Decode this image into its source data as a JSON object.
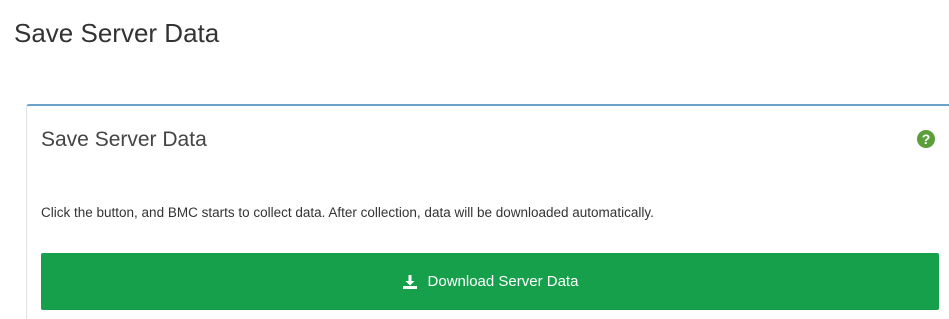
{
  "page": {
    "title": "Save Server Data"
  },
  "panel": {
    "title": "Save Server Data",
    "help_icon": "question-circle-icon",
    "description": "Click the button, and BMC starts to collect data. After collection, data will be downloaded automatically.",
    "download_button": {
      "label": "Download Server Data",
      "icon": "download-icon"
    }
  },
  "colors": {
    "accent_border": "#6ba2c9",
    "button_green": "#16a04b",
    "help_icon_green": "#5b9e3a"
  }
}
